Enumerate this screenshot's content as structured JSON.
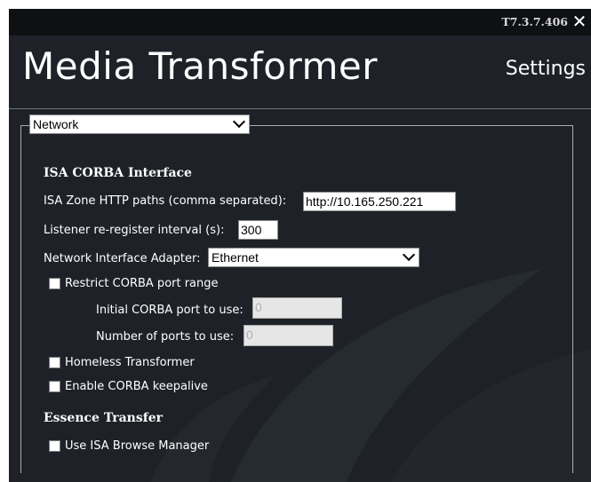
{
  "header": {
    "version": "T7.3.7.406",
    "close_glyph": "✕",
    "app_title": "Media Transformer",
    "page_title": "Settings"
  },
  "section_select": {
    "selected": "Network"
  },
  "corba": {
    "heading": "ISA CORBA Interface",
    "zone_paths_label": "ISA Zone HTTP paths (comma separated):",
    "zone_paths_value": "http://10.165.250.221",
    "reregister_label": "Listener re-register interval (s):",
    "reregister_value": "300",
    "adapter_label": "Network Interface Adapter:",
    "adapter_selected": "Ethernet",
    "restrict_label": "Restrict CORBA port range",
    "restrict_checked": false,
    "initial_port_label": "Initial CORBA port to use:",
    "initial_port_value": "0",
    "num_ports_label": "Number of ports to use:",
    "num_ports_value": "0",
    "homeless_label": "Homeless Transformer",
    "homeless_checked": false,
    "keepalive_label": "Enable CORBA keepalive",
    "keepalive_checked": false
  },
  "essence": {
    "heading": "Essence Transfer",
    "browse_manager_label": "Use ISA Browse Manager",
    "browse_manager_checked": false
  },
  "colors": {
    "background": "#1e2228",
    "topbar": "#0e1013",
    "divider": "#6e737a"
  }
}
